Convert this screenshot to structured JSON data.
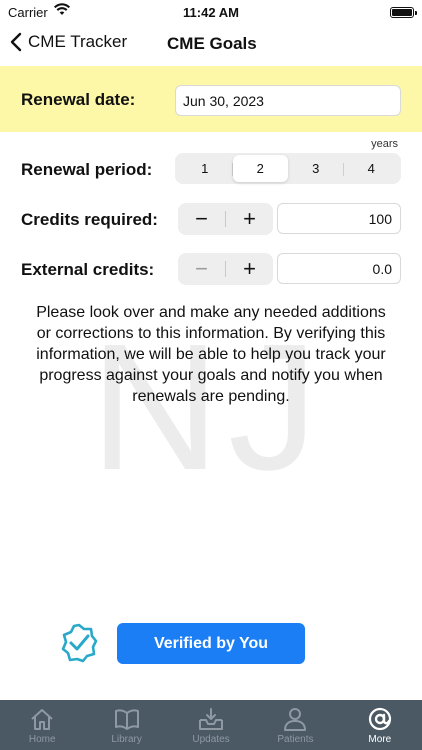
{
  "status_bar": {
    "carrier": "Carrier",
    "time": "11:42 AM"
  },
  "nav": {
    "back_label": "CME Tracker",
    "title": "CME Goals"
  },
  "renewal_date": {
    "label": "Renewal date:",
    "value": "Jun 30, 2023"
  },
  "renewal_period": {
    "label": "Renewal period:",
    "unit": "years",
    "options": [
      "1",
      "2",
      "3",
      "4"
    ],
    "selected": "2"
  },
  "credits_required": {
    "label": "Credits required:",
    "minus": "−",
    "plus": "+",
    "value": "100"
  },
  "external_credits": {
    "label": "External credits:",
    "minus": "−",
    "plus": "+",
    "value": "0.0"
  },
  "watermark": "NJ",
  "info_text": "Please look over and make any needed additions or corrections to this information. By verifying this information, we will be able to help you track your progress against your goals and notify you when renewals are pending.",
  "verify": {
    "button_label": "Verified by You",
    "icon": "verified-badge-icon",
    "accent": "#1b7ef5",
    "badge_color": "#29a8c9"
  },
  "tab_bar": {
    "background": "#4b5965",
    "tabs": [
      {
        "label": "Home",
        "icon": "home-icon"
      },
      {
        "label": "Library",
        "icon": "book-icon"
      },
      {
        "label": "Updates",
        "icon": "inbox-icon"
      },
      {
        "label": "Patients",
        "icon": "person-icon"
      },
      {
        "label": "More",
        "icon": "at-icon",
        "active": true
      }
    ]
  },
  "colors": {
    "highlight_row": "#fdf7a8"
  }
}
